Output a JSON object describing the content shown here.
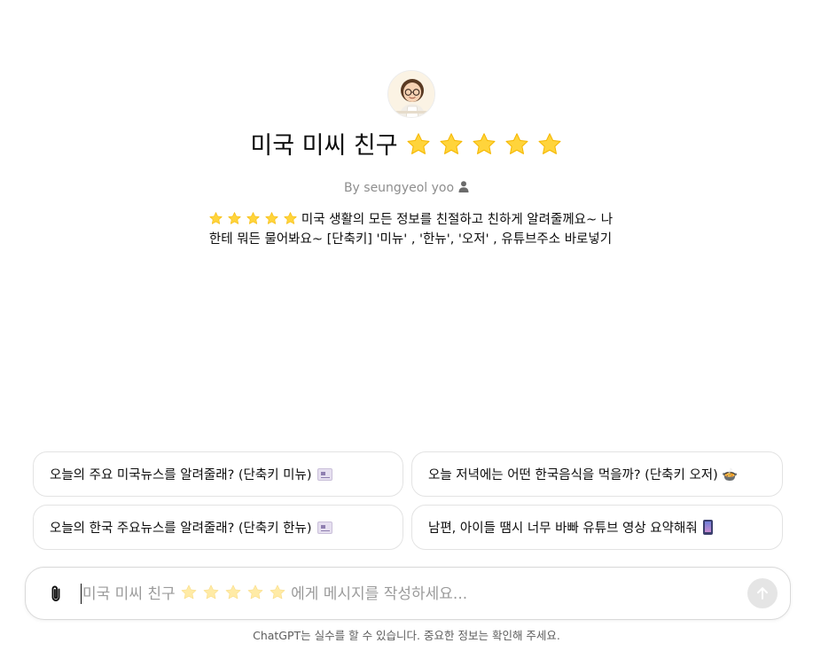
{
  "gpt": {
    "name": "미국 미씨 친구",
    "title_star_count": 5,
    "author": "By seungyeol yoo",
    "description_line1": "미국 생활의 모든 정보를 친절하고 친하게 알려줄께요~ 나",
    "description_line2": "한테 뭐든 물어봐요~ [단축키] '미뉴' , '한뉴', '오저' , 유튜브주소 바로넣기",
    "description_star_count": 5
  },
  "suggestions": [
    {
      "label": "오늘의 주요 미국뉴스를 알려줄래? (단축키 미뉴)",
      "icon": "newspaper-icon"
    },
    {
      "label": "오늘 저녁에는 어떤 한국음식을 먹을까? (단축키 오저) 🍲",
      "icon": ""
    },
    {
      "label": "오늘의 한국 주요뉴스를 알려줄래? (단축키 한뉴)",
      "icon": "newspaper-icon"
    },
    {
      "label": "남편, 아이들 땜시 너무 바빠 유튜브 영상 요약해줘",
      "icon": "mobile-phone-icon"
    }
  ],
  "composer": {
    "placeholder_prefix": "미국 미씨 친구",
    "placeholder_suffix": "에게 메시지를 작성하세요...",
    "attach_icon": "paperclip-icon",
    "send_icon": "arrow-up-icon"
  },
  "footer": {
    "disclaimer": "ChatGPT는 실수를 할 수 있습니다. 중요한 정보는 확인해 주세요."
  },
  "colors": {
    "star": "#FFD43B",
    "star_edge": "#F5B700",
    "muted_text": "#8e8e8e",
    "border": "#e3e3e3",
    "send_bg": "#e5e5e5"
  }
}
